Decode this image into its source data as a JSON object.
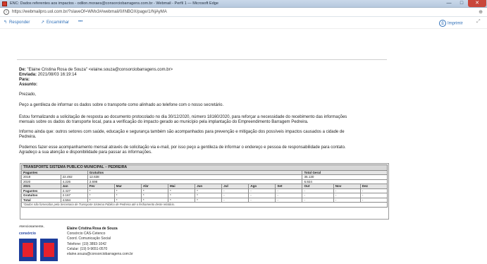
{
  "window": {
    "title": "ENC: Dados referentes aos impactos - odilon.moraes@consorciobarragens.com.br - Webmail - Perfil 1 — Microsoft Edge",
    "min_label": "—",
    "max_label": "□",
    "close_label": "✕"
  },
  "address": {
    "url": "https://webmailpro.uol.com.br/?slaveOf=WMx3#/webmail/0/INBOX/page/1/NjAyMA"
  },
  "toolbar": {
    "reply_label": "Responder",
    "forward_label": "Encaminhar",
    "more_label": "•••",
    "print_label": "Imprimir"
  },
  "email": {
    "de_label": "De:",
    "de_value": "\"Elaine Cristina Rosa de Souza\" <elaine.souza@consorciobarragens.com.br>",
    "enviada_label": "Enviada:",
    "enviada_value": "2021/08/03 16:19:14",
    "para_label": "Para:",
    "assunto_label": "Assunto:",
    "greeting": "Prezado,",
    "p1": "Peço a gentileza de informar os dados sobre o transporte  como alinhado ao telefone com o nosso secretário.",
    "p2a": "Estou formalizando a solicitação de resposta ao documento protocolado no dia 30/12/2020, número 18160/2020, para reforçar a necessidade do recebimento das informações",
    "p2b": "mensais sobre os dados do transporte local, para a verificação do impacto gerado ao município pela implantação do Empreendimento Barragem Pedreira.",
    "p3a": "Informo ainda que: outros setores com saúde, educação e segurança também são acompanhados para prevenção e mitigação dos possíveis impactos causados a cidade de",
    "p3b": "Pedreira.",
    "p4a": "Podemos fazer esse acompanhamento mensal através de solicitação via e-mail, por isso peço a gentileza de informar o endereço e pessoa de responsabilidade para contato.",
    "p4b": "Agradeço a sua atenção e disponibilidade para passar as informações."
  },
  "report": {
    "title": "TRANSPORTE SISTEMA PÚBLICO MUNICIPAL – PEDREIRA",
    "summary_headers": [
      "Pagantes",
      "Gratuitos",
      "Total Geral"
    ],
    "summary_rows": [
      [
        "2019",
        "22.492",
        "12.638",
        "35.130"
      ],
      [
        "2020",
        "4.226",
        "2.698",
        "6.924"
      ]
    ],
    "year_2021": "2021",
    "months": [
      "Jan",
      "Fev",
      "Mar",
      "Abr",
      "Mai",
      "Jun",
      "Jul",
      "Ago",
      "Set",
      "Out",
      "Nov",
      "Dez"
    ],
    "monthly_rows": [
      {
        "label": "Pagantes",
        "values": [
          "2.427",
          "*",
          "*",
          "*",
          "*",
          "*",
          "-",
          "-",
          "-",
          "-",
          "-",
          "-"
        ]
      },
      {
        "label": "Gratuitos",
        "values": [
          "2.167",
          "*",
          "*",
          "*",
          "*",
          "*",
          "-",
          "-",
          "-",
          "-",
          "-",
          "-"
        ]
      },
      {
        "label": "Total",
        "values": [
          "4.594",
          "*",
          "*",
          "*",
          "*",
          "*",
          "-",
          "-",
          "-",
          "-",
          "-",
          "-"
        ]
      }
    ],
    "note": "*Dados não fornecidos pela Secretaria de Transporte Sistema Público de Pedreira até o fechamento deste relatório."
  },
  "signature": {
    "closing": "Atenciosamente,",
    "brand": "consórcio",
    "logo_text": "BP",
    "name": "Elaine Cristina Rosa de Souza",
    "line1": "Consórcio CAS-Cetenco",
    "line2": "Coord. Comunicação Social",
    "phone": "Telefone: (19) 3893-1042",
    "cell": "Celular:  (19) 9-9651-0570",
    "email": "elaine.souza@consorciobarragens.com.br"
  },
  "colors": {
    "accent": "#2e6fb8",
    "logo_blue": "#1c3c9a",
    "logo_red": "#e7212b",
    "close_red": "#c9463b"
  }
}
